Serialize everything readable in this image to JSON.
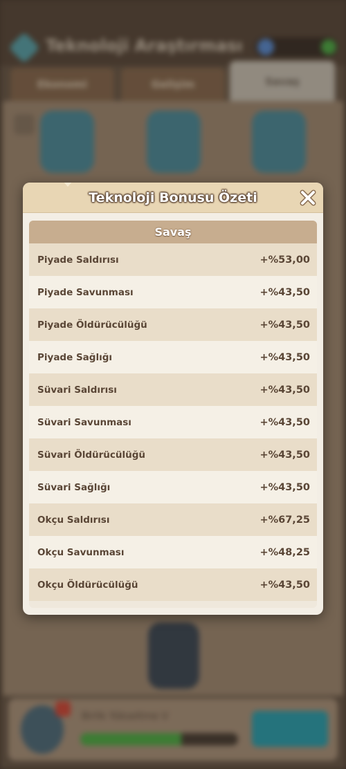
{
  "modal": {
    "title": "Teknoloji Bonusu Özeti",
    "section_title": "Savaş",
    "rows": [
      {
        "label": "Piyade Saldırısı",
        "value": "+%53,00"
      },
      {
        "label": "Piyade Savunması",
        "value": "+%43,50"
      },
      {
        "label": "Piyade Öldürücülüğü",
        "value": "+%43,50"
      },
      {
        "label": "Piyade Sağlığı",
        "value": "+%43,50"
      },
      {
        "label": "Süvari Saldırısı",
        "value": "+%43,50"
      },
      {
        "label": "Süvari Savunması",
        "value": "+%43,50"
      },
      {
        "label": "Süvari Öldürücülüğü",
        "value": "+%43,50"
      },
      {
        "label": "Süvari Sağlığı",
        "value": "+%43,50"
      },
      {
        "label": "Okçu Saldırısı",
        "value": "+%67,25"
      },
      {
        "label": "Okçu Savunması",
        "value": "+%48,25"
      },
      {
        "label": "Okçu Öldürücülüğü",
        "value": "+%43,50"
      }
    ],
    "close_icon": "close-icon"
  },
  "background": {
    "title": "Teknoloji Araştırması",
    "tabs": [
      "Ekonomi",
      "Gelişim",
      "Savaş"
    ],
    "currency_icon": "gem-icon",
    "bottom_text": "Birlik Yükseltme V",
    "bottom_progress": 0.64
  },
  "colors": {
    "modal_header": "#e8d6b4",
    "section_header": "#c7ad8f",
    "row_odd": "#e9ddc9",
    "row_even": "#f5f0e6",
    "text": "#5a4636",
    "close_x": "#ffffff"
  }
}
